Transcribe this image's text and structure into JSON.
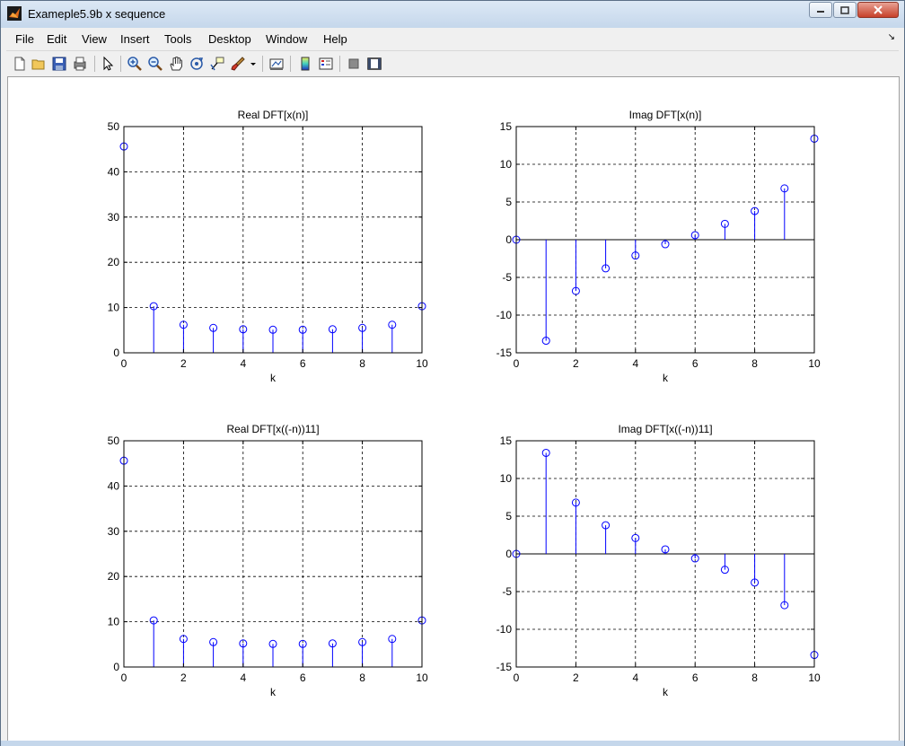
{
  "window": {
    "title": "Exameple5.9b x sequence"
  },
  "menu": {
    "items": [
      "File",
      "Edit",
      "View",
      "Insert",
      "Tools",
      "Desktop",
      "Window",
      "Help"
    ]
  },
  "toolbar": {
    "icons": [
      "new-figure-icon",
      "open-file-icon",
      "save-icon",
      "print-icon",
      "edit-plot-arrow-icon",
      "zoom-in-icon",
      "zoom-out-icon",
      "pan-hand-icon",
      "rotate-3d-icon",
      "data-cursor-icon",
      "brush-icon",
      "link-plot-icon",
      "colorbar-icon",
      "legend-icon",
      "hide-plot-tools-icon",
      "show-plot-tools-icon"
    ]
  },
  "colors": {
    "stem": "#0000ff",
    "grid": "#000000",
    "axes_bg": "#ffffff"
  },
  "chart_data": [
    {
      "type": "stem",
      "title": "Real DFT[x(n)]",
      "xlabel": "k",
      "ylabel": "",
      "xlim": [
        0,
        10
      ],
      "ylim": [
        0,
        50
      ],
      "xticks": [
        0,
        2,
        4,
        6,
        8,
        10
      ],
      "yticks": [
        0,
        10,
        20,
        30,
        40,
        50
      ],
      "grid": true,
      "x": [
        0,
        1,
        2,
        3,
        4,
        5,
        6,
        7,
        8,
        9,
        10
      ],
      "y": [
        45.6,
        10.3,
        6.2,
        5.5,
        5.2,
        5.1,
        5.1,
        5.2,
        5.5,
        6.2,
        10.3
      ]
    },
    {
      "type": "stem",
      "title": "Imag DFT[x(n)]",
      "xlabel": "k",
      "ylabel": "",
      "xlim": [
        0,
        10
      ],
      "ylim": [
        -15,
        15
      ],
      "xticks": [
        0,
        2,
        4,
        6,
        8,
        10
      ],
      "yticks": [
        -15,
        -10,
        -5,
        0,
        5,
        10,
        15
      ],
      "grid": true,
      "x": [
        0,
        1,
        2,
        3,
        4,
        5,
        6,
        7,
        8,
        9,
        10
      ],
      "y": [
        0,
        -13.4,
        -6.8,
        -3.8,
        -2.1,
        -0.6,
        0.6,
        2.1,
        3.8,
        6.8,
        13.4
      ]
    },
    {
      "type": "stem",
      "title": "Real DFT[x((-n))11]",
      "xlabel": "k",
      "ylabel": "",
      "xlim": [
        0,
        10
      ],
      "ylim": [
        0,
        50
      ],
      "xticks": [
        0,
        2,
        4,
        6,
        8,
        10
      ],
      "yticks": [
        0,
        10,
        20,
        30,
        40,
        50
      ],
      "grid": true,
      "x": [
        0,
        1,
        2,
        3,
        4,
        5,
        6,
        7,
        8,
        9,
        10
      ],
      "y": [
        45.6,
        10.3,
        6.2,
        5.5,
        5.2,
        5.1,
        5.1,
        5.2,
        5.5,
        6.2,
        10.3
      ]
    },
    {
      "type": "stem",
      "title": "Imag DFT[x((-n))11]",
      "xlabel": "k",
      "ylabel": "",
      "xlim": [
        0,
        10
      ],
      "ylim": [
        -15,
        15
      ],
      "xticks": [
        0,
        2,
        4,
        6,
        8,
        10
      ],
      "yticks": [
        -15,
        -10,
        -5,
        0,
        5,
        10,
        15
      ],
      "grid": true,
      "x": [
        0,
        1,
        2,
        3,
        4,
        5,
        6,
        7,
        8,
        9,
        10
      ],
      "y": [
        0,
        13.4,
        6.8,
        3.8,
        2.1,
        0.6,
        -0.6,
        -2.1,
        -3.8,
        -6.8,
        -13.4
      ]
    }
  ]
}
